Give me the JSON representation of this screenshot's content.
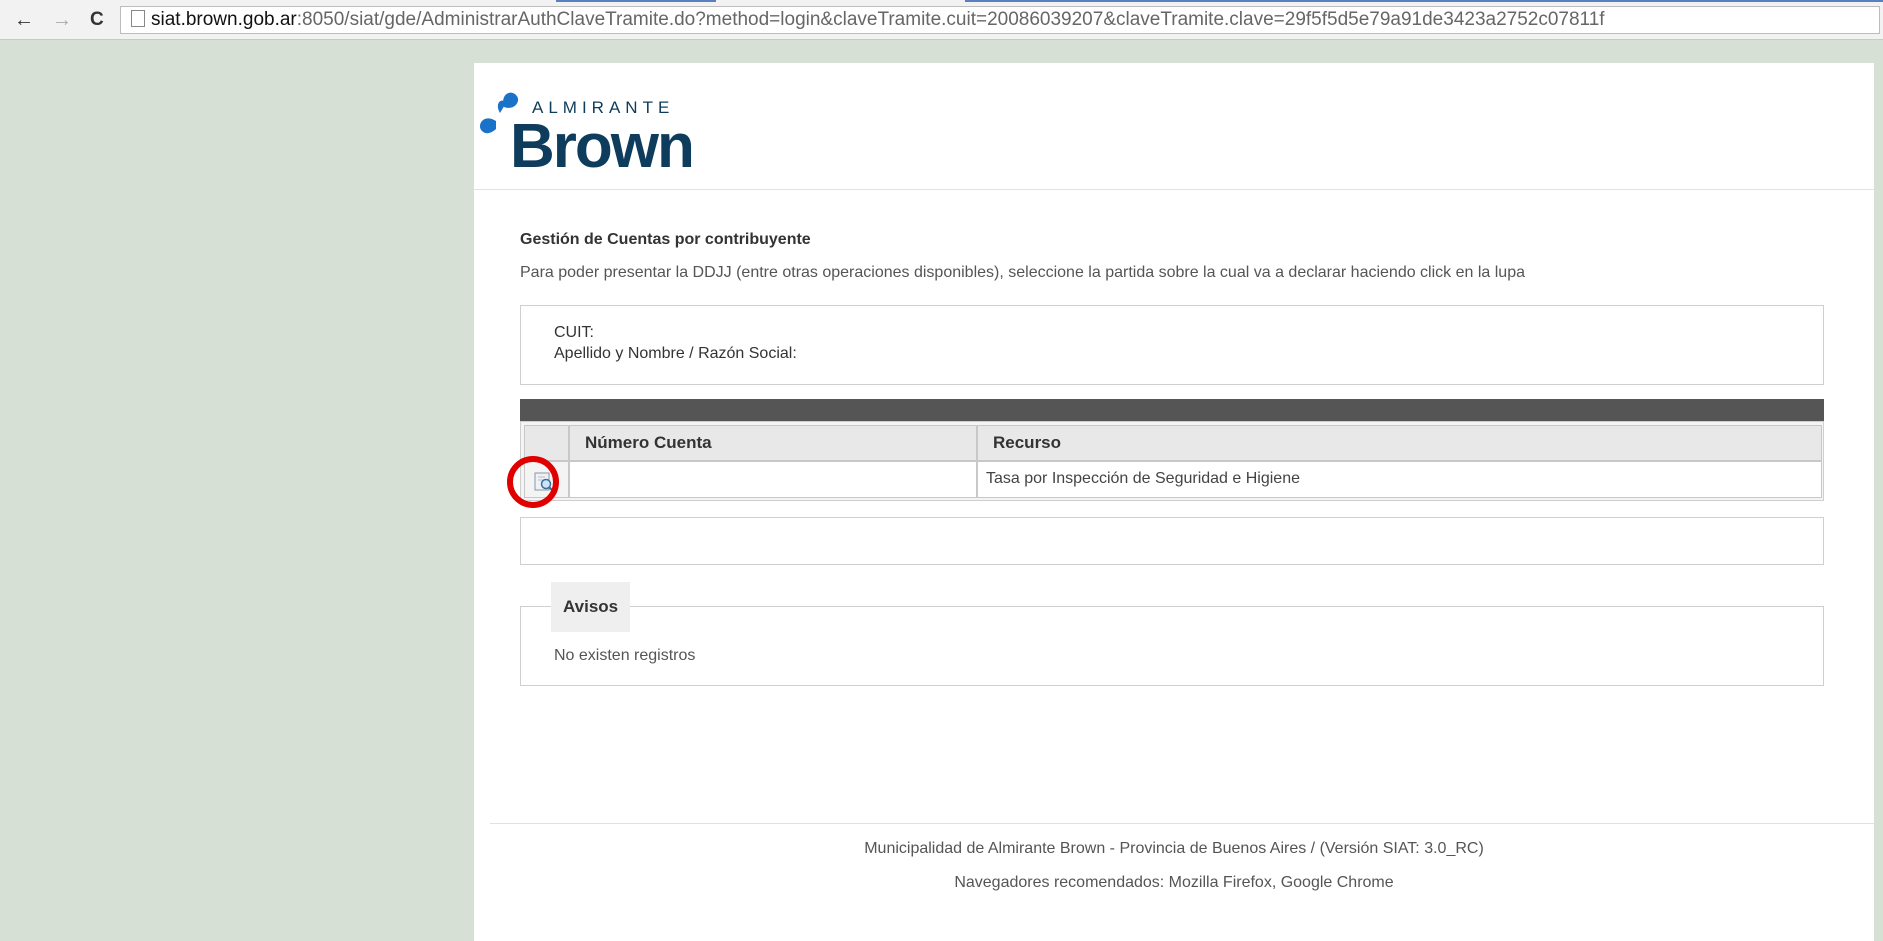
{
  "browser": {
    "back": "←",
    "forward": "→",
    "reload": "C",
    "url_host": "siat.brown.gob.ar",
    "url_path": ":8050/siat/gde/AdministrarAuthClaveTramite.do?method=login&claveTramite.cuit=20086039207&claveTramite.clave=29f5f5d5e79a91de3423a2752c07811f"
  },
  "logo": {
    "top": "ALMIRANTE",
    "main": "Brown",
    "brand_blue": "#1a73c9",
    "brand_dark": "#0e3c5c"
  },
  "page": {
    "title": "Gestión de Cuentas por contribuyente",
    "intro": "Para poder presentar la DDJJ (entre otras operaciones disponibles), seleccione la partida sobre la cual va a declarar haciendo click en la lupa"
  },
  "info": {
    "cuit_label": "CUIT:",
    "name_label": "Apellido y Nombre / Razón Social:"
  },
  "table": {
    "headers": [
      "",
      "Número Cuenta",
      "Recurso"
    ],
    "rows": [
      {
        "icon": "magnifier-icon",
        "numero_cuenta": "",
        "recurso": "Tasa por Inspección de Seguridad e Higiene"
      }
    ]
  },
  "avisos": {
    "legend": "Avisos",
    "text": "No existen registros"
  },
  "footer": {
    "line1": "Municipalidad de Almirante Brown - Provincia de Buenos Aires / (Versión SIAT: 3.0_RC)",
    "line2": "Navegadores recomendados: Mozilla Firefox, Google Chrome"
  },
  "colors": {
    "highlight": "#e00000",
    "page_bg": "#d6e0d4",
    "grid_bar": "#555555"
  }
}
